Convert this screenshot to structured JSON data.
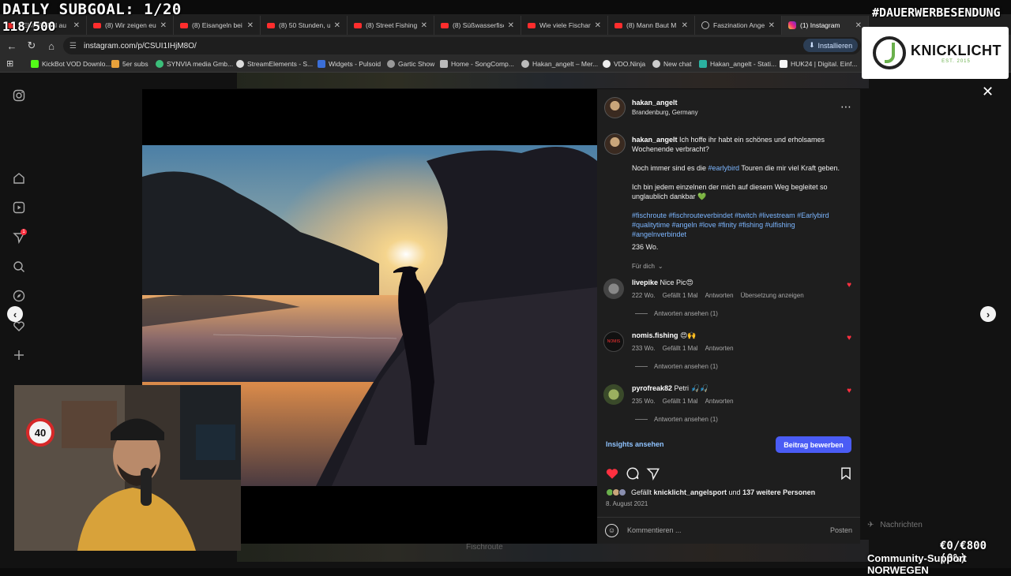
{
  "stream": {
    "subgoal": "DAILY SUBGOAL: 1/20",
    "subcount": "118/500",
    "ad_tag": "#DAUERWERBESENDUNG",
    "sponsor_name": "KNICKLICHT",
    "sponsor_est": "EST. 2015",
    "donation": "€0/€800 (0%)",
    "community": "Community-Support NORWEGEN"
  },
  "browser": {
    "tabs": [
      {
        "label": "NEUHEITEN au",
        "icon": "youtube-icon"
      },
      {
        "label": "(8) Wir zeigen eu",
        "icon": "youtube-icon"
      },
      {
        "label": "(8) Eisangeln bei",
        "icon": "youtube-icon"
      },
      {
        "label": "(8) 50 Stunden, u",
        "icon": "youtube-icon"
      },
      {
        "label": "(8) Street Fishing",
        "icon": "youtube-icon"
      },
      {
        "label": "(8) Süßwasserfisc",
        "icon": "youtube-icon"
      },
      {
        "label": "Wie viele Fischart",
        "icon": "youtube-icon"
      },
      {
        "label": "(8) Mann Baut M",
        "icon": "youtube-icon"
      },
      {
        "label": "Faszination Angel",
        "icon": "globe-icon"
      },
      {
        "label": "(1) Instagram",
        "icon": "instagram-icon"
      }
    ],
    "url": "instagram.com/p/CSUI1IHjM8O/",
    "install_label": "Installieren",
    "bookmarks": [
      "KickBot VOD Downlo...",
      "5er subs",
      "SYNVIA media Gmb...",
      "StreamElements - S...",
      "Widgets - Pulsoid",
      "Gartic Show",
      "Home - SongComp...",
      "Hakan_angelt – Mer...",
      "VDO.Ninja",
      "New chat",
      "Hakan_angelt - Stati...",
      "HUK24 | Digital. Einf..."
    ]
  },
  "post": {
    "username": "hakan_angelt",
    "location": "Brandenburg, Germany",
    "caption_line1": "Ich hoffe ihr habt ein schönes und erholsames Wochenende verbracht?",
    "caption_p2_pre": "Noch immer sind es die ",
    "caption_p2_tag": "#earlybird",
    "caption_p2_post": " Touren die mir viel Kraft geben.",
    "caption_p3": "Ich bin jedem einzelnen der mich auf diesem Weg begleitet so unglaublich dankbar 💚",
    "hashtags": "#fischroute #fischrouteverbindet #twitch #livestream #Earlybird #qualitytime #angeln #love #finity #fishing #ulfishing #angelnverbindet",
    "caption_age": "236 Wo.",
    "for_you": "Für dich",
    "comments": [
      {
        "user": "livepike",
        "text": "Nice Pic😍",
        "age": "222 Wo.",
        "likes": "Gefällt 1 Mal",
        "reply": "Antworten",
        "extra": "Übersetzung anzeigen",
        "replies": "Antworten ansehen (1)"
      },
      {
        "user": "nomis.fishing",
        "text": "😍🙌",
        "age": "233 Wo.",
        "likes": "Gefällt 1 Mal",
        "reply": "Antworten",
        "extra": "",
        "replies": "Antworten ansehen (1)"
      },
      {
        "user": "pyrofreak82",
        "text": "Petri 🎣🎣",
        "age": "235 Wo.",
        "likes": "Gefällt 1 Mal",
        "reply": "Antworten",
        "extra": "",
        "replies": "Antworten ansehen (1)"
      }
    ],
    "insights": "Insights ansehen",
    "promote": "Beitrag bewerben",
    "likes_pre": "Gefällt ",
    "likes_user": "knicklicht_angelsport",
    "likes_mid": " und ",
    "likes_count": "137 weitere Personen",
    "date": "8. August 2021",
    "comment_placeholder": "Kommentieren ...",
    "post_button": "Posten"
  },
  "background": {
    "strip_text": "Fischroute",
    "messages": "Nachrichten",
    "notification_badge": "1"
  },
  "colors": {
    "accent_blue": "#4a5cf5",
    "like_red": "#ff3040",
    "hashtag_blue": "#7cb6ff"
  }
}
